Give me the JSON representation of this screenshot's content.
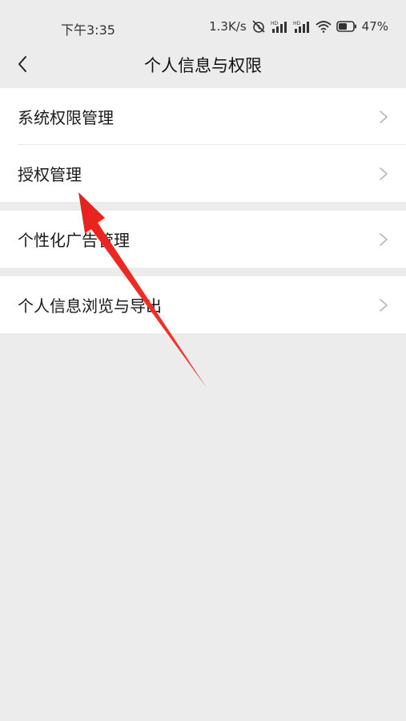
{
  "status_bar": {
    "time": "下午3:35",
    "net_speed": "1.3K/s",
    "battery": "47%",
    "icons": [
      "alarm-off-icon",
      "signal-hd-icon",
      "signal-hd-icon",
      "wifi-icon",
      "battery-icon"
    ]
  },
  "nav": {
    "back_icon": "chevron-left-icon",
    "title": "个人信息与权限"
  },
  "groups": [
    {
      "items": [
        {
          "label": "系统权限管理"
        },
        {
          "label": "授权管理"
        }
      ]
    },
    {
      "items": [
        {
          "label": "个性化广告管理"
        }
      ]
    },
    {
      "items": [
        {
          "label": "个人信息浏览与导出"
        }
      ]
    }
  ],
  "colors": {
    "background": "#ececec",
    "card": "#ffffff",
    "annotation_arrow": "#e8201c"
  }
}
